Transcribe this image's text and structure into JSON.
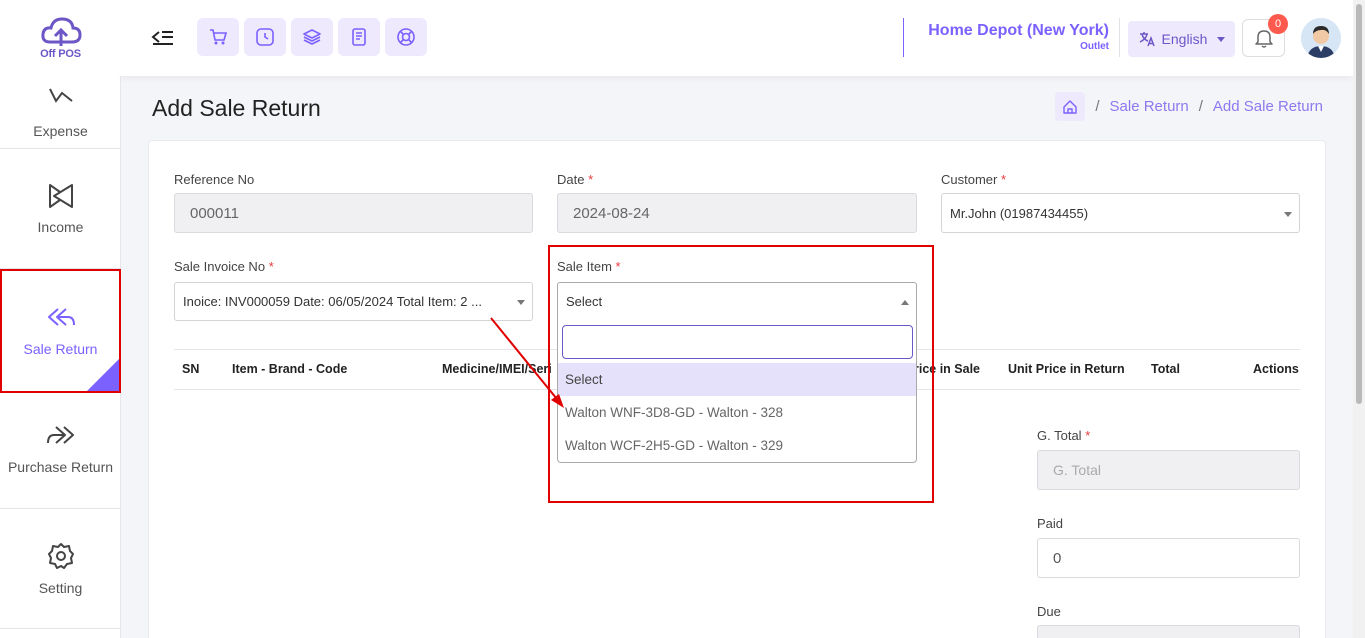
{
  "logo": {
    "text": "Off POS"
  },
  "sidebar": {
    "items": [
      {
        "label": "Expense",
        "icon": "expense-icon"
      },
      {
        "label": "Income",
        "icon": "income-icon"
      },
      {
        "label": "Sale Return",
        "icon": "sale-return-icon",
        "active": true
      },
      {
        "label": "Purchase Return",
        "icon": "purchase-return-icon"
      },
      {
        "label": "Setting",
        "icon": "gear-icon"
      }
    ]
  },
  "header": {
    "outlet_name": "Home Depot (New York)",
    "outlet_sub": "Outlet",
    "language": "English",
    "notification_count": "0"
  },
  "page": {
    "title": "Add Sale Return",
    "breadcrumb": [
      "Sale Return",
      "Add Sale Return"
    ]
  },
  "form": {
    "reference_label": "Reference No",
    "reference_value": "000011",
    "date_label": "Date",
    "date_value": "2024-08-24",
    "customer_label": "Customer",
    "customer_value": "Mr.John (01987434455)",
    "invoice_label": "Sale Invoice No",
    "invoice_value": "Inoice: INV000059 Date: 06/05/2024 Total Item: 2 ...",
    "sale_item_label": "Sale Item",
    "sale_item_value": "Select",
    "required_mark": "*"
  },
  "table": {
    "headers": [
      "SN",
      "Item - Brand - Code",
      "Medicine/IMEI/Seri",
      "rice in Sale",
      "Unit Price in Return",
      "Total",
      "Actions"
    ]
  },
  "dropdown": {
    "search_value": "",
    "options": [
      "Select",
      "Walton WNF-3D8-GD - Walton - 328",
      "Walton WCF-2H5-GD - Walton - 329"
    ]
  },
  "totals": {
    "gtotal_label": "G. Total",
    "gtotal_placeholder": "G. Total",
    "paid_label": "Paid",
    "paid_value": "0",
    "due_label": "Due"
  },
  "colors": {
    "accent": "#7b61ff",
    "annotation": "#e00000"
  }
}
